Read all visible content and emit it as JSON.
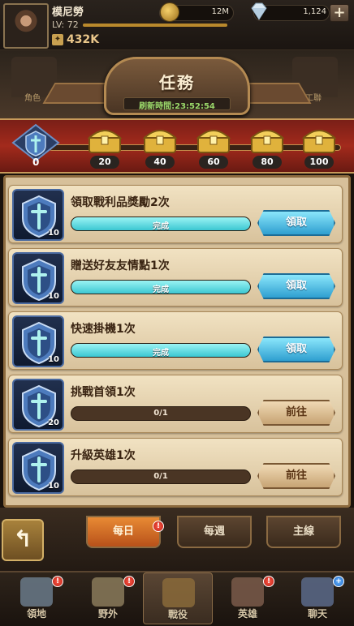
{
  "player": {
    "name": "模尼勞",
    "level": "LV: 72",
    "level_progress": 1.0,
    "power": "432K"
  },
  "currency": {
    "gold": "12M",
    "gems": "1,124",
    "add_label": "+"
  },
  "header": {
    "title": "任務",
    "refresh": "刷新時間:23:52:54",
    "left_label": "角色",
    "right_label": "工聯"
  },
  "rewards": {
    "current": "0",
    "milestones": [
      "20",
      "40",
      "60",
      "80",
      "100"
    ]
  },
  "tasks": [
    {
      "name": "領取戰利品獎勵2次",
      "points": "10",
      "progress_text": "完成",
      "progress": 1.0,
      "button": "領取",
      "state": "claim"
    },
    {
      "name": "贈送好友友情點1次",
      "points": "10",
      "progress_text": "完成",
      "progress": 1.0,
      "button": "領取",
      "state": "claim"
    },
    {
      "name": "快速掛機1次",
      "points": "10",
      "progress_text": "完成",
      "progress": 1.0,
      "button": "領取",
      "state": "claim"
    },
    {
      "name": "挑戰首領1次",
      "points": "20",
      "progress_text": "0/1",
      "progress": 0.0,
      "button": "前往",
      "state": "go"
    },
    {
      "name": "升級英雄1次",
      "points": "10",
      "progress_text": "0/1",
      "progress": 0.0,
      "button": "前往",
      "state": "go"
    }
  ],
  "tabs": [
    {
      "label": "每日",
      "active": true,
      "alert": "!"
    },
    {
      "label": "每週",
      "active": false
    },
    {
      "label": "主線",
      "active": false
    }
  ],
  "back_label": "↰",
  "nav": [
    {
      "label": "領地",
      "icon": "castle-icon",
      "alert": "!"
    },
    {
      "label": "野外",
      "icon": "map-scroll-icon",
      "alert": "!"
    },
    {
      "label": "戰役",
      "icon": "battle-crest-icon",
      "active": true
    },
    {
      "label": "英雄",
      "icon": "hero-icon",
      "alert": "!"
    },
    {
      "label": "聊天",
      "icon": "chat-icon",
      "alert": "+"
    }
  ],
  "colors": {
    "claim": "#2f9fd0",
    "go": "#c7a474",
    "progress_fill": "#3bc7d2",
    "active_tab": "#e88a34"
  }
}
